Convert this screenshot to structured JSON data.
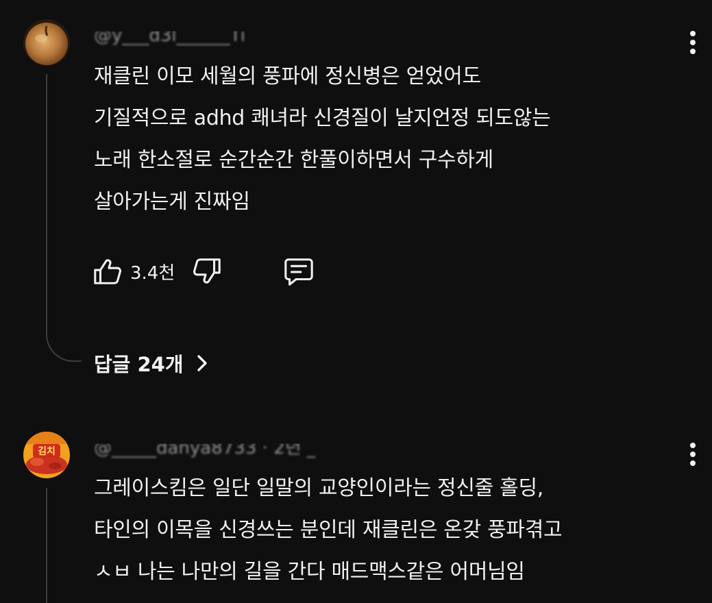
{
  "comments": [
    {
      "author": "@y___d3l______Ti",
      "text": "재클린 이모 세월의 풍파에 정신병은 얻었어도\n기질적으로 adhd 쾌녀라 신경질이 날지언정 되도않는\n노래 한소절로 순간순간 한풀이하면서 구수하게\n살아가는게 진짜임",
      "likes": "3.4천",
      "replies_label": "답글 24개",
      "avatar_icon": "apple-avatar-icon"
    },
    {
      "author": "@_____danya8733 · 2년 _",
      "text": "그레이스킴은 일단 일말의 교양인이라는 정신줄 홀딩,\n타인의 이목을 신경쓰는 분인데 재클린은 온갖 풍파겪고\nㅅㅂ 나는 나만의 길을 간다 매드맥스같은 어머님임",
      "avatar_icon": "kimchi-ramen-avatar-icon",
      "avatar_label": "김치"
    }
  ],
  "colors": {
    "background": "#0f0f0f",
    "text": "#f1f1f1",
    "secondary_text": "#aaaaaa",
    "thread_line": "#3d3d3d"
  }
}
